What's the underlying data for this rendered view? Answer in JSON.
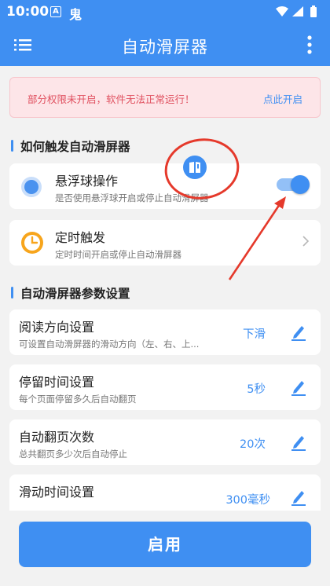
{
  "status_bar": {
    "time": "10:00",
    "a_icon": "A",
    "app_icon": "鬼"
  },
  "header": {
    "title": "自动滑屏器",
    "menu_icon": "hamburger-menu-icon",
    "more_icon": "more-vertical-icon"
  },
  "warning": {
    "text": "部分权限未开启，软件无法正常运行！",
    "link": "点此开启",
    "color": "#e0505f"
  },
  "section_trigger": {
    "title": "如何触发自动滑屏器"
  },
  "floating_ball_card": {
    "title": "悬浮球操作",
    "subtitle": "是否使用悬浮球开启或停止自动滑屏器",
    "enabled": true
  },
  "timer_card": {
    "title": "定时触发",
    "subtitle": "定时时间开启或停止自动滑屏器"
  },
  "section_params": {
    "title": "自动滑屏器参数设置"
  },
  "params": [
    {
      "title": "阅读方向设置",
      "subtitle": "可设置自动滑屏器的滑动方向（左、右、上...",
      "value": "下滑"
    },
    {
      "title": "停留时间设置",
      "subtitle": "每个页面停留多久后自动翻页",
      "value": "5秒"
    },
    {
      "title": "自动翻页次数",
      "subtitle": "总共翻页多少次后自动停止",
      "value": "20次"
    },
    {
      "title": "滑动时间设置",
      "subtitle": "",
      "value": "300毫秒"
    }
  ],
  "enable_button": {
    "label": "启用"
  },
  "colors": {
    "primary": "#3f8ff2",
    "annotation": "#e5392b",
    "background": "#f2f2f2"
  }
}
